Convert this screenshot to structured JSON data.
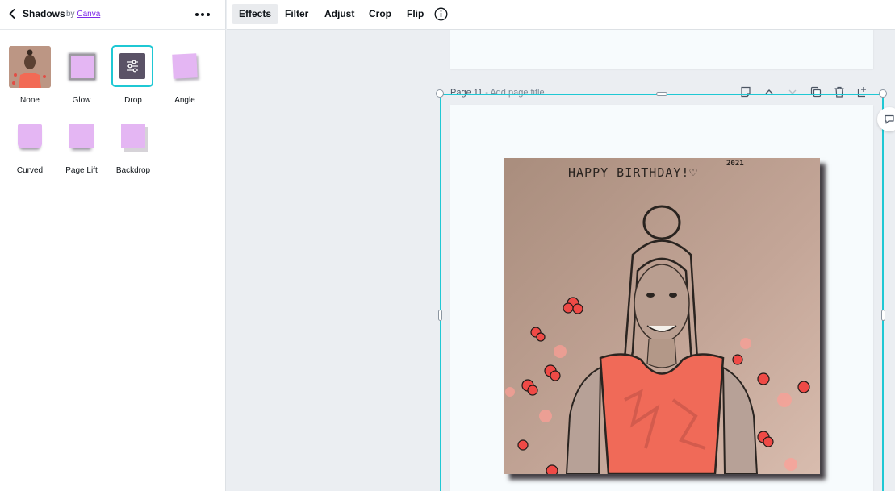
{
  "panel": {
    "title": "Shadows",
    "by_prefix": "by",
    "by_link": "Canva",
    "effects": [
      {
        "label": "None"
      },
      {
        "label": "Glow"
      },
      {
        "label": "Drop"
      },
      {
        "label": "Angle"
      },
      {
        "label": "Curved"
      },
      {
        "label": "Page Lift"
      },
      {
        "label": "Backdrop"
      }
    ],
    "selected_effect": "Drop"
  },
  "toolbar": {
    "items": [
      {
        "label": "Effects",
        "active": true
      },
      {
        "label": "Filter"
      },
      {
        "label": "Adjust"
      },
      {
        "label": "Crop"
      },
      {
        "label": "Flip"
      }
    ],
    "info_icon": "info-icon"
  },
  "canvas": {
    "page_number": "Page 11",
    "page_title_placeholder": "- Add page title",
    "page_actions": [
      "note-icon",
      "chevron-up-icon",
      "chevron-down-icon",
      "duplicate-icon",
      "trash-icon",
      "add-page-icon"
    ],
    "photo": {
      "text": "HAPPY BIRTHDAY!♡",
      "year": "2021"
    }
  },
  "colors": {
    "accent_selection": "#1fc8d4",
    "brand_link": "#7d2ae8",
    "thumb_fill": "#e4b6f3"
  }
}
